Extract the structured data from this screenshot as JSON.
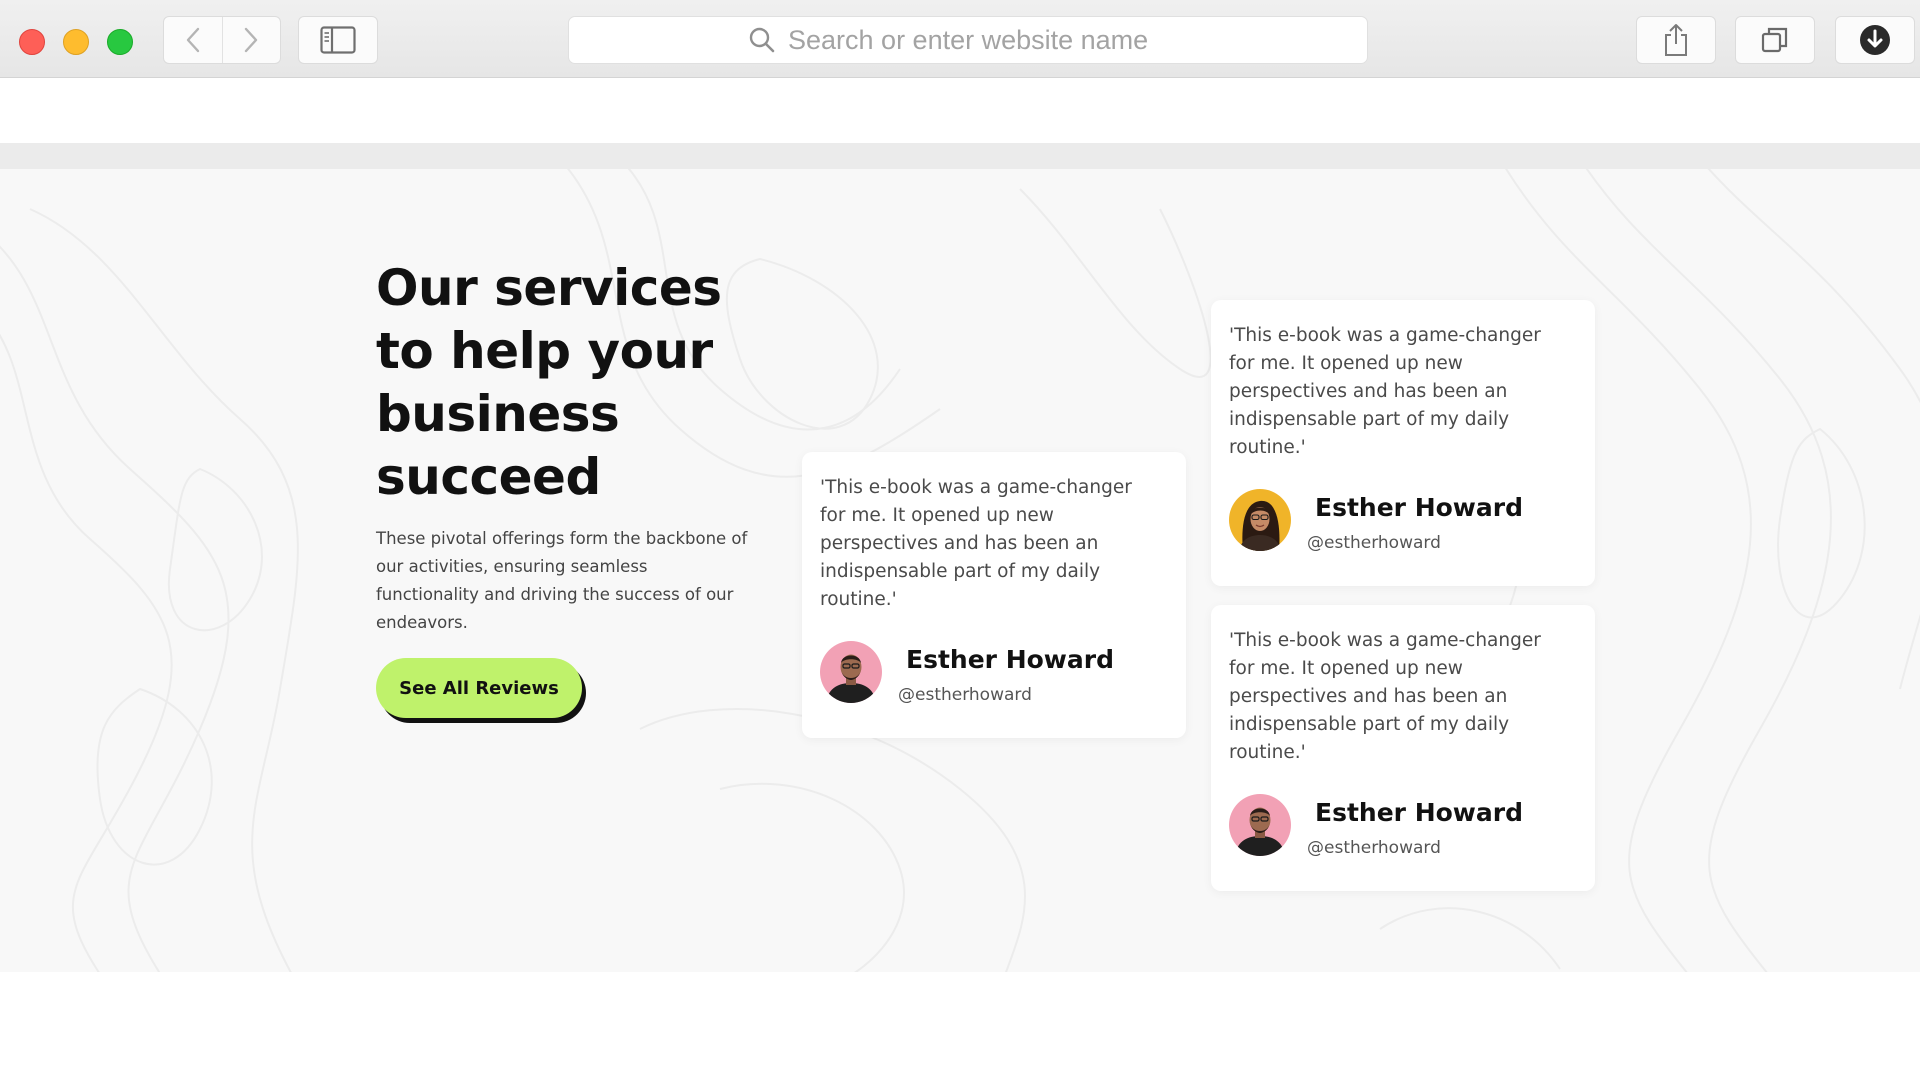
{
  "browser": {
    "address_placeholder": "Search or enter website name"
  },
  "hero": {
    "title_lines": [
      "Our services",
      "to help your",
      "business",
      "succeed"
    ],
    "description_lines": [
      "These pivotal offerings form the backbone of",
      "our activities, ensuring seamless",
      "functionality and driving the success of our",
      "endeavors."
    ],
    "cta_label": "See All Reviews"
  },
  "reviews": [
    {
      "quote_lines": [
        "'This e-book was a game-changer",
        "for me. It opened up new",
        "perspectives and has been an",
        "indispensable part of my daily",
        "routine.'"
      ],
      "name": "Esther Howard",
      "handle": "@estherhoward",
      "avatar": "man-avatar"
    },
    {
      "quote_lines": [
        "'This e-book was a game-changer",
        "for me. It opened up new",
        "perspectives and has been an",
        "indispensable part of my daily",
        "routine.'"
      ],
      "name": "Esther Howard",
      "handle": "@estherhoward",
      "avatar": "woman-avatar"
    },
    {
      "quote_lines": [
        "'This e-book was a game-changer",
        "for me. It opened up new",
        "perspectives and has been an",
        "indispensable part of my daily",
        "routine.'"
      ],
      "name": "Esther Howard",
      "handle": "@estherhoward",
      "avatar": "man-avatar"
    }
  ],
  "colors": {
    "accent": "#bff26b",
    "text": "#111111",
    "background": "#f8f8f8"
  }
}
